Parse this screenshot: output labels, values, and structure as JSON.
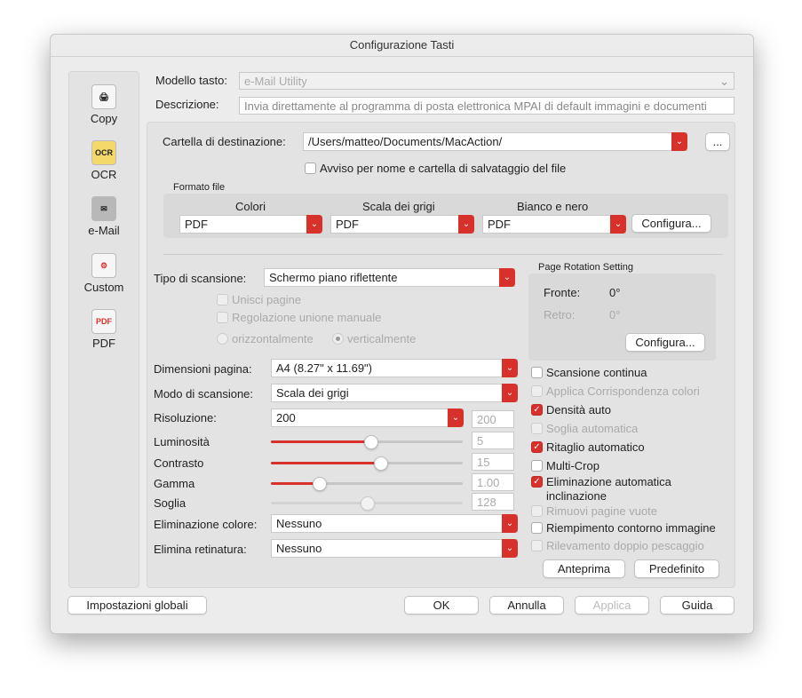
{
  "window": {
    "title": "Configurazione Tasti"
  },
  "sidebar": {
    "items": [
      {
        "label": "Copy",
        "icon": "printer-icon"
      },
      {
        "label": "OCR",
        "icon": "ocr-icon"
      },
      {
        "label": "e-Mail",
        "icon": "email-icon"
      },
      {
        "label": "Custom",
        "icon": "custom-icon"
      },
      {
        "label": "PDF",
        "icon": "pdf-icon"
      }
    ],
    "selected": "e-Mail"
  },
  "header": {
    "model_label": "Modello tasto:",
    "model_value": "e-Mail Utility",
    "desc_label": "Descrizione:",
    "desc_value": "Invia direttamente al programma di posta elettronica MPAI di default immagini e documenti"
  },
  "destination": {
    "label": "Cartella di destinazione:",
    "value": "/Users/matteo/Documents/MacAction/",
    "browse": "...",
    "notify_label": "Avviso per nome e cartella di salvataggio del file",
    "notify_checked": false
  },
  "file_format": {
    "title": "Formato file",
    "columns": [
      {
        "label": "Colori",
        "value": "PDF"
      },
      {
        "label": "Scala dei grigi",
        "value": "PDF"
      },
      {
        "label": "Bianco e nero",
        "value": "PDF"
      }
    ],
    "configure": "Configura..."
  },
  "scan": {
    "type_label": "Tipo di scansione:",
    "type_value": "Schermo piano riflettente",
    "merge_pages": "Unisci pagine",
    "manual_merge": "Regolazione unione manuale",
    "horizontal": "orizzontalmente",
    "vertical": "verticalmente",
    "page_size_label": "Dimensioni pagina:",
    "page_size_value": "A4 (8.27\" x 11.69\")",
    "mode_label": "Modo di scansione:",
    "mode_value": "Scala dei grigi",
    "resolution_label": "Risoluzione:",
    "resolution_value": "200",
    "resolution_field": "200",
    "sliders": [
      {
        "label": "Luminosità",
        "value": "5",
        "fraction": 0.52,
        "enabled": true
      },
      {
        "label": "Contrasto",
        "value": "15",
        "fraction": 0.57,
        "enabled": true
      },
      {
        "label": "Gamma",
        "value": "1.00",
        "fraction": 0.25,
        "enabled": true
      },
      {
        "label": "Soglia",
        "value": "128",
        "fraction": 0.5,
        "enabled": false
      }
    ],
    "color_drop_label": "Eliminazione colore:",
    "color_drop_value": "Nessuno",
    "descreen_label": "Elimina retinatura:",
    "descreen_value": "Nessuno"
  },
  "rotation": {
    "title": "Page Rotation Setting",
    "front_label": "Fronte:",
    "front_value": "0°",
    "back_label": "Retro:",
    "back_value": "0°",
    "configure": "Configura..."
  },
  "options": [
    {
      "label": "Scansione continua",
      "checked": false,
      "enabled": true
    },
    {
      "label": "Applica Corrispondenza colori",
      "checked": false,
      "enabled": false
    },
    {
      "label": "Densità auto",
      "checked": true,
      "enabled": true
    },
    {
      "label": "Soglia automatica",
      "checked": false,
      "enabled": false
    },
    {
      "label": "Ritaglio automatico",
      "checked": true,
      "enabled": true
    },
    {
      "label": "Multi-Crop",
      "checked": false,
      "enabled": true
    },
    {
      "label": "Eliminazione automatica inclinazione",
      "checked": true,
      "enabled": true
    },
    {
      "label": "Rimuovi pagine vuote",
      "checked": false,
      "enabled": false
    },
    {
      "label": "Riempimento contorno immagine",
      "checked": false,
      "enabled": true
    },
    {
      "label": "Rilevamento doppio pescaggio",
      "checked": false,
      "enabled": false
    }
  ],
  "panel_buttons": {
    "preview": "Anteprima",
    "default": "Predefinito"
  },
  "footer": {
    "global": "Impostazioni globali",
    "ok": "OK",
    "cancel": "Annulla",
    "apply": "Applica",
    "help": "Guida"
  },
  "colors": {
    "accent": "#d8302a"
  }
}
